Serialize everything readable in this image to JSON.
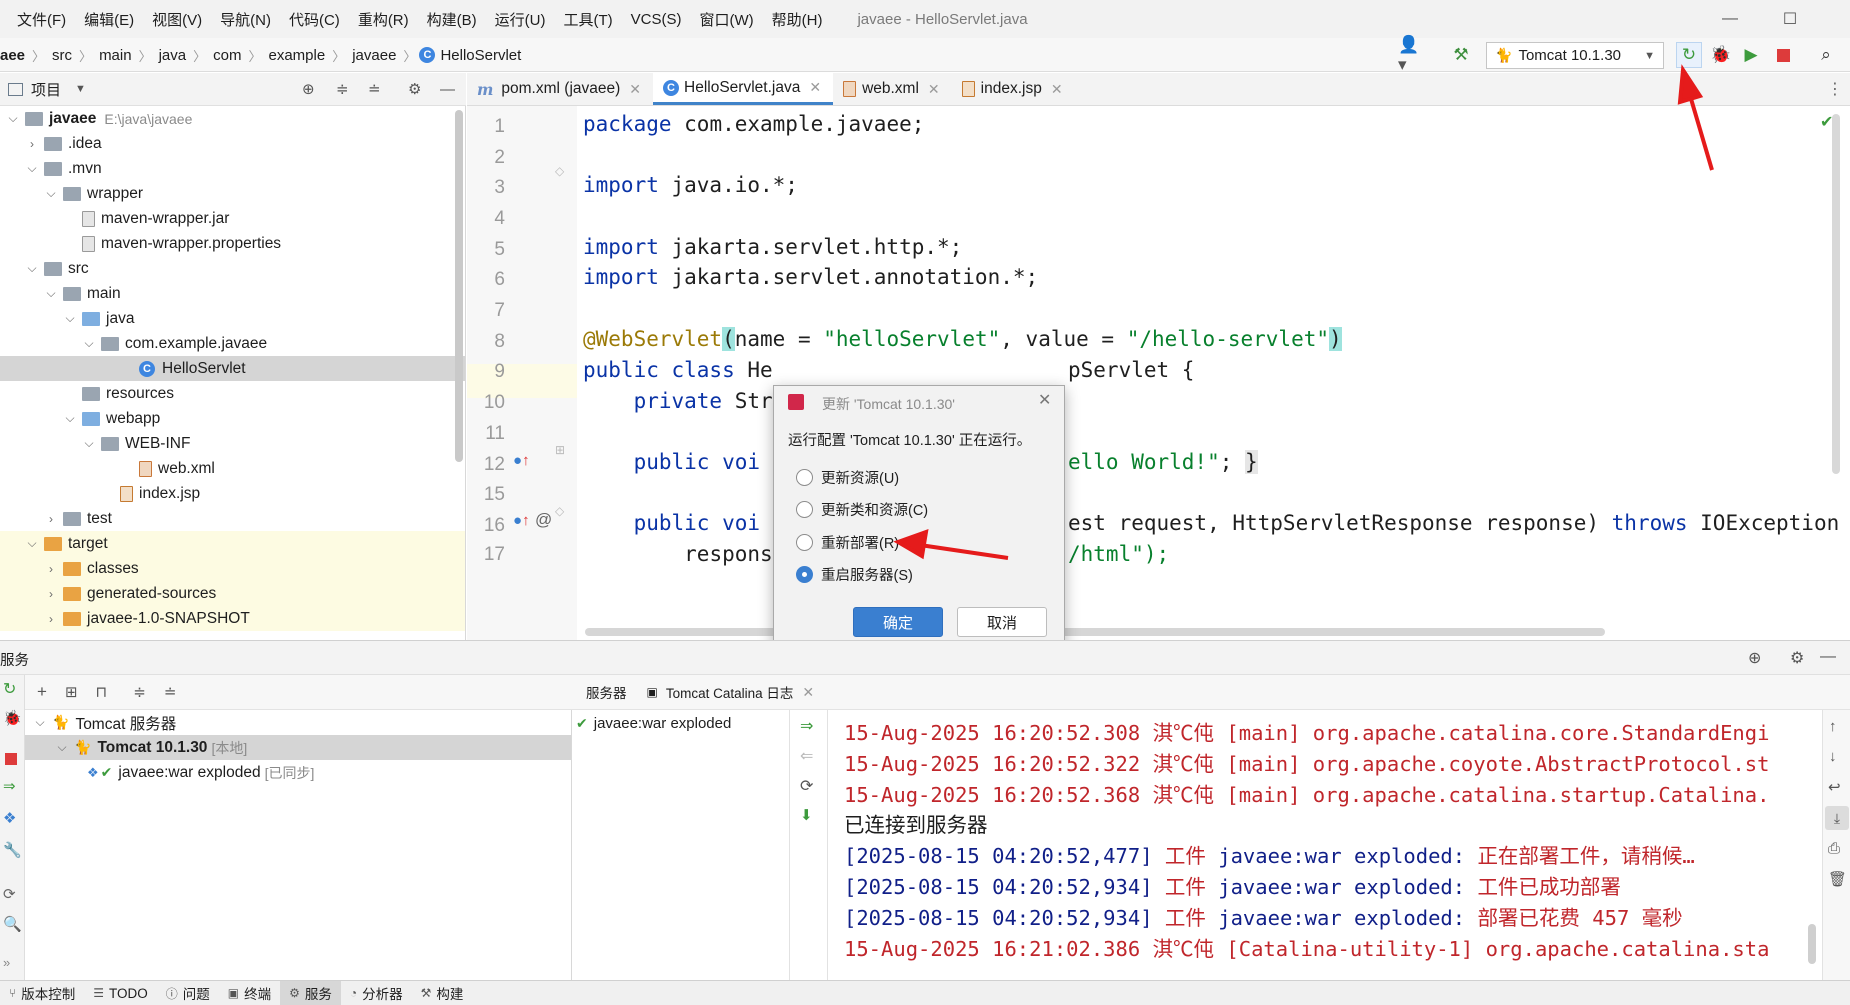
{
  "menu": {
    "items": [
      "文件(F)",
      "编辑(E)",
      "视图(V)",
      "导航(N)",
      "代码(C)",
      "重构(R)",
      "构建(B)",
      "运行(U)",
      "工具(T)",
      "VCS(S)",
      "窗口(W)",
      "帮助(H)"
    ],
    "window_title": "javaee - HelloServlet.java"
  },
  "breadcrumb": [
    "aee",
    "src",
    "main",
    "java",
    "com",
    "example",
    "javaee",
    "HelloServlet"
  ],
  "toolbar": {
    "run_config": "Tomcat 10.1.30"
  },
  "project": {
    "title": "项目",
    "tree": [
      {
        "label": "javaee",
        "extra": "E:\\java\\javaee",
        "depth": 0,
        "icon": "module",
        "arrow": "open",
        "bold": true
      },
      {
        "label": ".idea",
        "depth": 1,
        "icon": "folder",
        "arrow": "closed"
      },
      {
        "label": ".mvn",
        "depth": 1,
        "icon": "folder",
        "arrow": "open"
      },
      {
        "label": "wrapper",
        "depth": 2,
        "icon": "folder",
        "arrow": "open"
      },
      {
        "label": "maven-wrapper.jar",
        "depth": 3,
        "icon": "file",
        "arrow": ""
      },
      {
        "label": "maven-wrapper.properties",
        "depth": 3,
        "icon": "file",
        "arrow": ""
      },
      {
        "label": "src",
        "depth": 1,
        "icon": "folder",
        "arrow": "open"
      },
      {
        "label": "main",
        "depth": 2,
        "icon": "folder",
        "arrow": "open"
      },
      {
        "label": "java",
        "depth": 3,
        "icon": "blue",
        "arrow": "open"
      },
      {
        "label": "com.example.javaee",
        "depth": 4,
        "icon": "folder",
        "arrow": "open"
      },
      {
        "label": "HelloServlet",
        "depth": 6,
        "icon": "class",
        "arrow": "",
        "selected": true
      },
      {
        "label": "resources",
        "depth": 3,
        "icon": "folder",
        "arrow": ""
      },
      {
        "label": "webapp",
        "depth": 3,
        "icon": "blue",
        "arrow": "open"
      },
      {
        "label": "WEB-INF",
        "depth": 4,
        "icon": "folder",
        "arrow": "open"
      },
      {
        "label": "web.xml",
        "depth": 6,
        "icon": "xml",
        "arrow": ""
      },
      {
        "label": "index.jsp",
        "depth": 5,
        "icon": "jsp",
        "arrow": ""
      },
      {
        "label": "test",
        "depth": 2,
        "icon": "folder",
        "arrow": "closed"
      },
      {
        "label": "target",
        "depth": 1,
        "icon": "orange",
        "arrow": "open",
        "excluded": true
      },
      {
        "label": "classes",
        "depth": 2,
        "icon": "orange",
        "arrow": "closed",
        "excluded": true
      },
      {
        "label": "generated-sources",
        "depth": 2,
        "icon": "orange",
        "arrow": "closed",
        "excluded": true
      },
      {
        "label": "javaee-1.0-SNAPSHOT",
        "depth": 2,
        "icon": "orange",
        "arrow": "closed",
        "excluded": true
      }
    ]
  },
  "tabs": [
    {
      "label": "pom.xml (javaee)",
      "active": false
    },
    {
      "label": "HelloServlet.java",
      "active": true
    },
    {
      "label": "web.xml",
      "active": false
    },
    {
      "label": "index.jsp",
      "active": false
    }
  ],
  "code": {
    "line_numbers": [
      "1",
      "2",
      "3",
      "4",
      "5",
      "6",
      "7",
      "8",
      "9",
      "10",
      "11",
      "12",
      "15",
      "16",
      "17"
    ],
    "l1": [
      "package",
      " com.example.javaee;"
    ],
    "l3": [
      "import",
      " java.io.*;"
    ],
    "l5": [
      "import",
      " jakarta.servlet.http.*;"
    ],
    "l6": [
      "import",
      " jakarta.servlet.annotation.*;"
    ],
    "l8": [
      "@WebServlet",
      "(",
      "name = ",
      "\"helloServlet\"",
      ", value = ",
      "\"/hello-servlet\"",
      ")"
    ],
    "l9": [
      "public class",
      " He",
      "pServlet {"
    ],
    "l10": [
      "private",
      " Str"
    ],
    "l12": [
      "public voi",
      "ello World!\"",
      "; ",
      "}"
    ],
    "l16": [
      "public voi",
      "est request, HttpServletResponse response) ",
      "throws",
      " IOException"
    ],
    "l17": [
      "respons",
      "/html\");"
    ]
  },
  "dialog": {
    "title": "更新 'Tomcat 10.1.30'",
    "message": "运行配置 'Tomcat 10.1.30' 正在运行。",
    "options": [
      "更新资源(U)",
      "更新类和资源(C)",
      "重新部署(R)",
      "重启服务器(S)"
    ],
    "selected_index": 3,
    "ok": "确定",
    "cancel": "取消"
  },
  "services": {
    "title": "服务",
    "tree": [
      {
        "label": "Tomcat 服务器",
        "extra": ""
      },
      {
        "label": "Tomcat 10.1.30",
        "extra": "[本地]"
      },
      {
        "label": "javaee:war exploded",
        "extra": "[已同步]"
      }
    ],
    "tabs": [
      "服务器",
      "Tomcat Catalina 日志"
    ],
    "deployment": "javaee:war exploded",
    "log": [
      {
        "parts": [
          "15-Aug-2025 16:20:52.308 ",
          "淇℃伅",
          " [main] org.apache.catalina.core.StandardEngi"
        ],
        "style": "red"
      },
      {
        "parts": [
          "15-Aug-2025 16:20:52.322 ",
          "淇℃伅",
          " [main] org.apache.coyote.AbstractProtocol.st"
        ],
        "style": "red"
      },
      {
        "parts": [
          "15-Aug-2025 16:20:52.368 ",
          "淇℃伅",
          " [main] org.apache.catalina.startup.Catalina."
        ],
        "style": "red"
      },
      {
        "parts": [
          "已连接到服务器"
        ],
        "style": "plain"
      },
      {
        "parts": [
          "[2025-08-15 04:20:52,477] ",
          "工件",
          " javaee:war exploded: ",
          "正在部署工件，请稍候…"
        ],
        "style": "navy"
      },
      {
        "parts": [
          "[2025-08-15 04:20:52,934] ",
          "工件",
          " javaee:war exploded: ",
          "工件已成功部署"
        ],
        "style": "navy"
      },
      {
        "parts": [
          "[2025-08-15 04:20:52,934] ",
          "工件",
          " javaee:war exploded: ",
          "部署已花费 457 毫秒"
        ],
        "style": "navy"
      },
      {
        "parts": [
          "15-Aug-2025 16:21:02.386 ",
          "淇℃伅",
          " [Catalina-utility-1] org.apache.catalina.sta"
        ],
        "style": "red"
      }
    ]
  },
  "statusbar": [
    "版本控制",
    "TODO",
    "问题",
    "终端",
    "服务",
    "分析器",
    "构建"
  ],
  "colors": {
    "accent": "#4083c9",
    "keyword": "#0a33a6",
    "string": "#08802d",
    "annotation": "#9b7a07",
    "log_red": "#c0262b",
    "arrow": "#e51b1b"
  }
}
